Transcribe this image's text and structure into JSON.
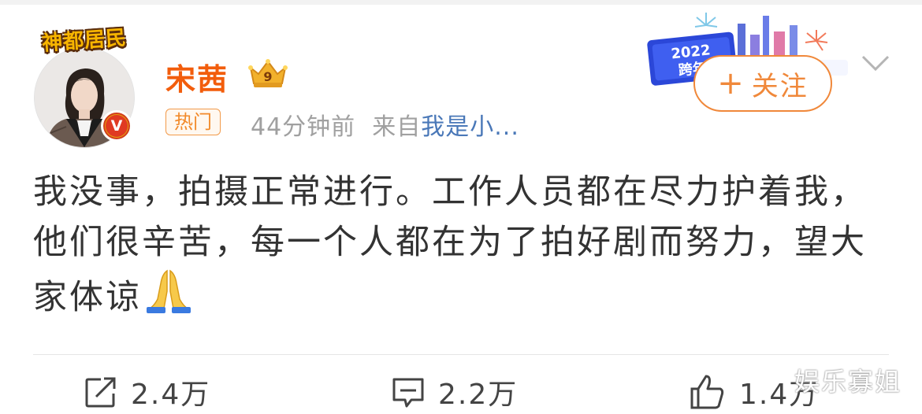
{
  "post": {
    "badge_text": "神都居民",
    "username": "宋茜",
    "member_level": "9",
    "hot_tag": "热门",
    "time": "44分钟前",
    "from_label": "来自",
    "source": "我是小...",
    "follow_label": "关注",
    "content": "我没事，拍摄正常进行。工作人员都在尽力护着我，他们很辛苦，每一个人都在为了拍好剧而努力，望大家体谅",
    "emoji": "folded-hands"
  },
  "banner": {
    "year": "2022",
    "label": "跨年"
  },
  "actions": {
    "repost_count": "2.4万",
    "comment_count": "2.2万",
    "like_count": "1.4万"
  },
  "watermark": "娱乐寡姐",
  "colors": {
    "username": "#f25d0c",
    "follow": "#f0883a",
    "source_link": "#4a78b8"
  }
}
